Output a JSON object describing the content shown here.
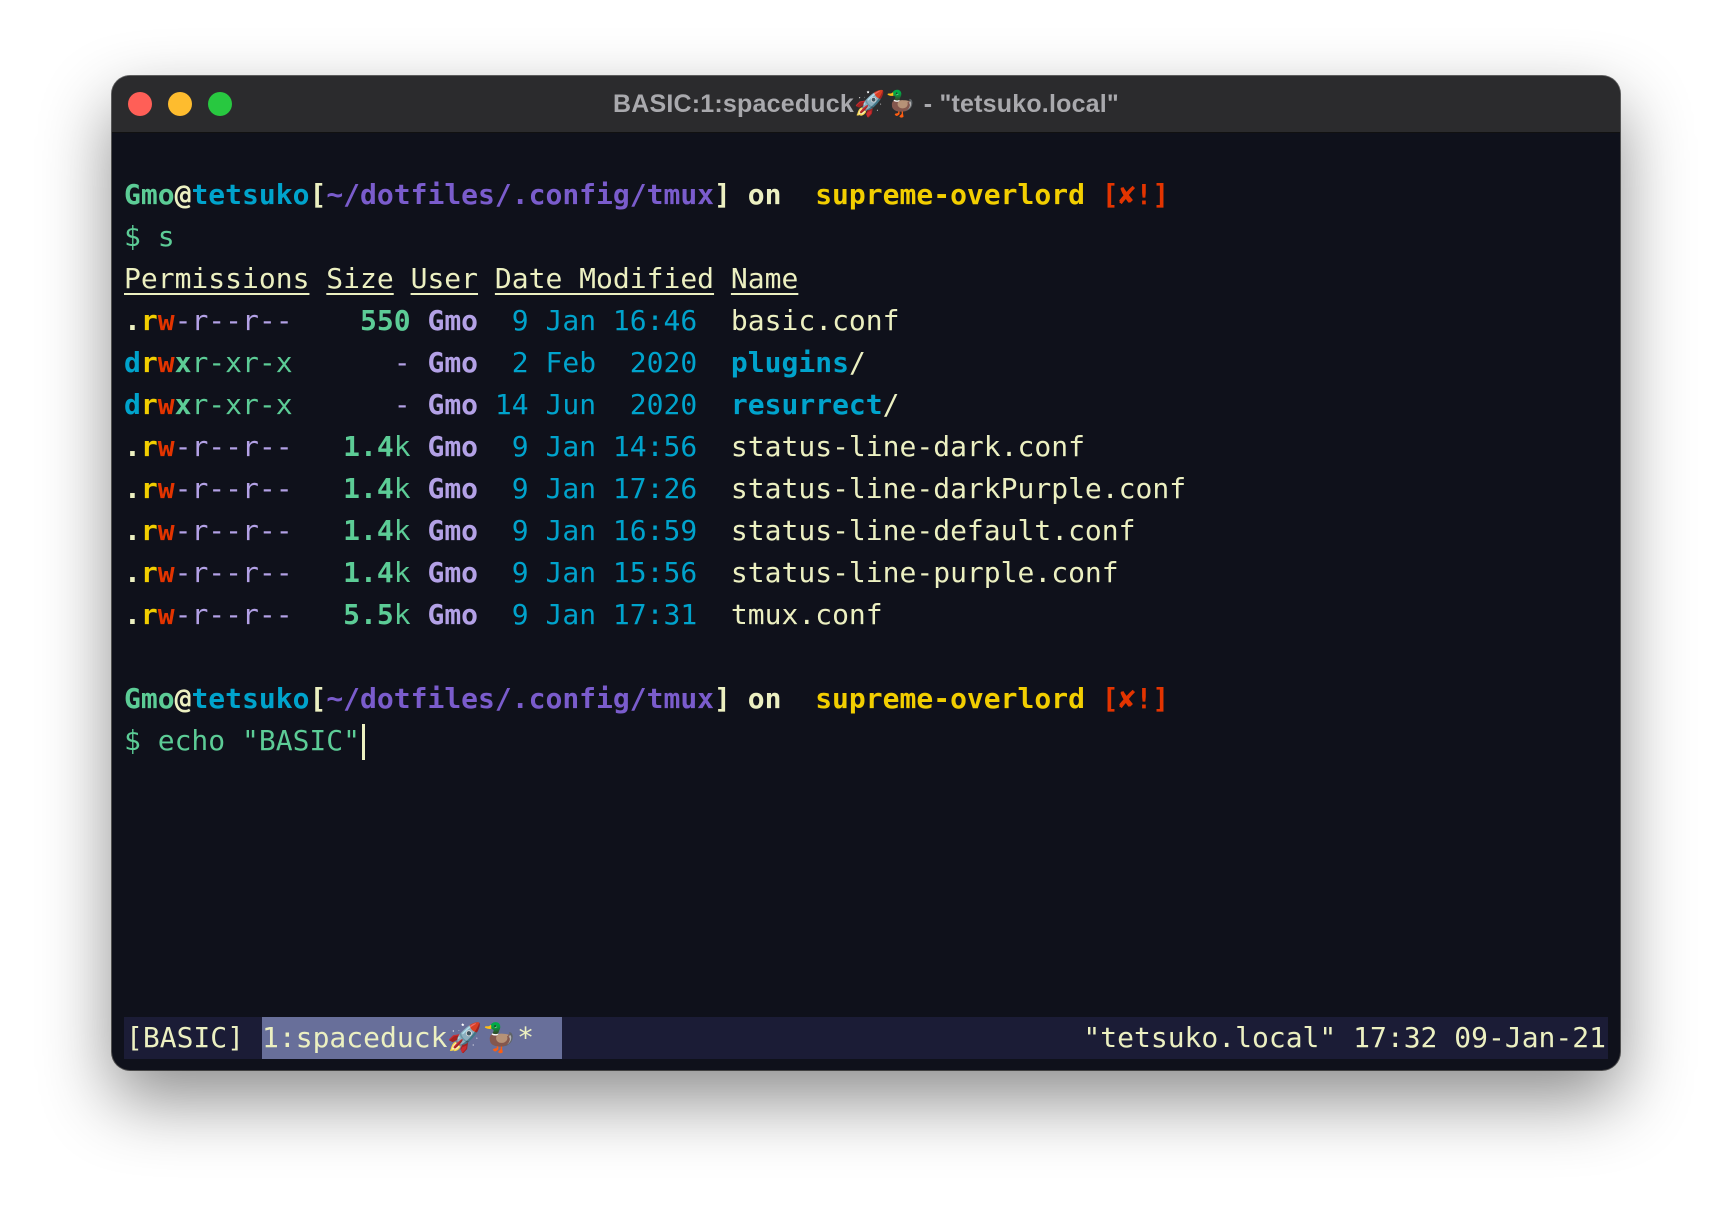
{
  "window": {
    "title": "BASIC:1:spaceduck🚀🦆 - \"tetsuko.local\""
  },
  "prompt": {
    "user": "Gmo",
    "at": "@",
    "host": "tetsuko",
    "path_open": "[",
    "path": "~/dotfiles/.config/tmux",
    "path_close": "]",
    "on": " on ",
    "branch_icon": "",
    "branch": "supreme-overlord",
    "status": "[✘!]"
  },
  "commands": [
    {
      "symbol": "$",
      "text": "s"
    },
    {
      "symbol": "$",
      "text": "echo \"BASIC\""
    }
  ],
  "listing": {
    "headers": [
      "Permissions",
      "Size",
      "User",
      "Date Modified",
      "Name"
    ],
    "rows": [
      {
        "perm_type": ".",
        "perm_r": "r",
        "perm_w": "w",
        "perm_x": "-",
        "perm_rest": "r--r--",
        "size": "550",
        "size_unit": "",
        "user": "Gmo",
        "date": " 9 Jan 16:46",
        "name": "basic.conf",
        "name_suffix": "",
        "is_dir": false
      },
      {
        "perm_type": "d",
        "perm_r": "r",
        "perm_w": "w",
        "perm_x": "x",
        "perm_rest": "r-xr-x",
        "size": "-",
        "size_unit": "",
        "user": "Gmo",
        "date": " 2 Feb  2020",
        "name": "plugins",
        "name_suffix": "/",
        "is_dir": true
      },
      {
        "perm_type": "d",
        "perm_r": "r",
        "perm_w": "w",
        "perm_x": "x",
        "perm_rest": "r-xr-x",
        "size": "-",
        "size_unit": "",
        "user": "Gmo",
        "date": "14 Jun  2020",
        "name": "resurrect",
        "name_suffix": "/",
        "is_dir": true
      },
      {
        "perm_type": ".",
        "perm_r": "r",
        "perm_w": "w",
        "perm_x": "-",
        "perm_rest": "r--r--",
        "size": "1.4",
        "size_unit": "k",
        "user": "Gmo",
        "date": " 9 Jan 14:56",
        "name": "status-line-dark.conf",
        "name_suffix": "",
        "is_dir": false
      },
      {
        "perm_type": ".",
        "perm_r": "r",
        "perm_w": "w",
        "perm_x": "-",
        "perm_rest": "r--r--",
        "size": "1.4",
        "size_unit": "k",
        "user": "Gmo",
        "date": " 9 Jan 17:26",
        "name": "status-line-darkPurple.conf",
        "name_suffix": "",
        "is_dir": false
      },
      {
        "perm_type": ".",
        "perm_r": "r",
        "perm_w": "w",
        "perm_x": "-",
        "perm_rest": "r--r--",
        "size": "1.4",
        "size_unit": "k",
        "user": "Gmo",
        "date": " 9 Jan 16:59",
        "name": "status-line-default.conf",
        "name_suffix": "",
        "is_dir": false
      },
      {
        "perm_type": ".",
        "perm_r": "r",
        "perm_w": "w",
        "perm_x": "-",
        "perm_rest": "r--r--",
        "size": "1.4",
        "size_unit": "k",
        "user": "Gmo",
        "date": " 9 Jan 15:56",
        "name": "status-line-purple.conf",
        "name_suffix": "",
        "is_dir": false
      },
      {
        "perm_type": ".",
        "perm_r": "r",
        "perm_w": "w",
        "perm_x": "-",
        "perm_rest": "r--r--",
        "size": "5.5",
        "size_unit": "k",
        "user": "Gmo",
        "date": " 9 Jan 17:31",
        "name": "tmux.conf",
        "name_suffix": "",
        "is_dir": false
      }
    ]
  },
  "statusbar": {
    "session": "[BASIC]",
    "window": "1:spaceduck🚀🦆*",
    "right": "\"tetsuko.local\" 17:32 09-Jan-21"
  },
  "colors": {
    "background": "#0f111b",
    "foreground": "#ecf0c1",
    "green": "#5ccc96",
    "cyan": "#00a3cc",
    "purple": "#7a5ccc",
    "lavender": "#b3a1e6",
    "yellow": "#f2ce00",
    "red": "#e33400",
    "status_bg": "#1b1c36",
    "status_window_bg": "#686f9a"
  }
}
